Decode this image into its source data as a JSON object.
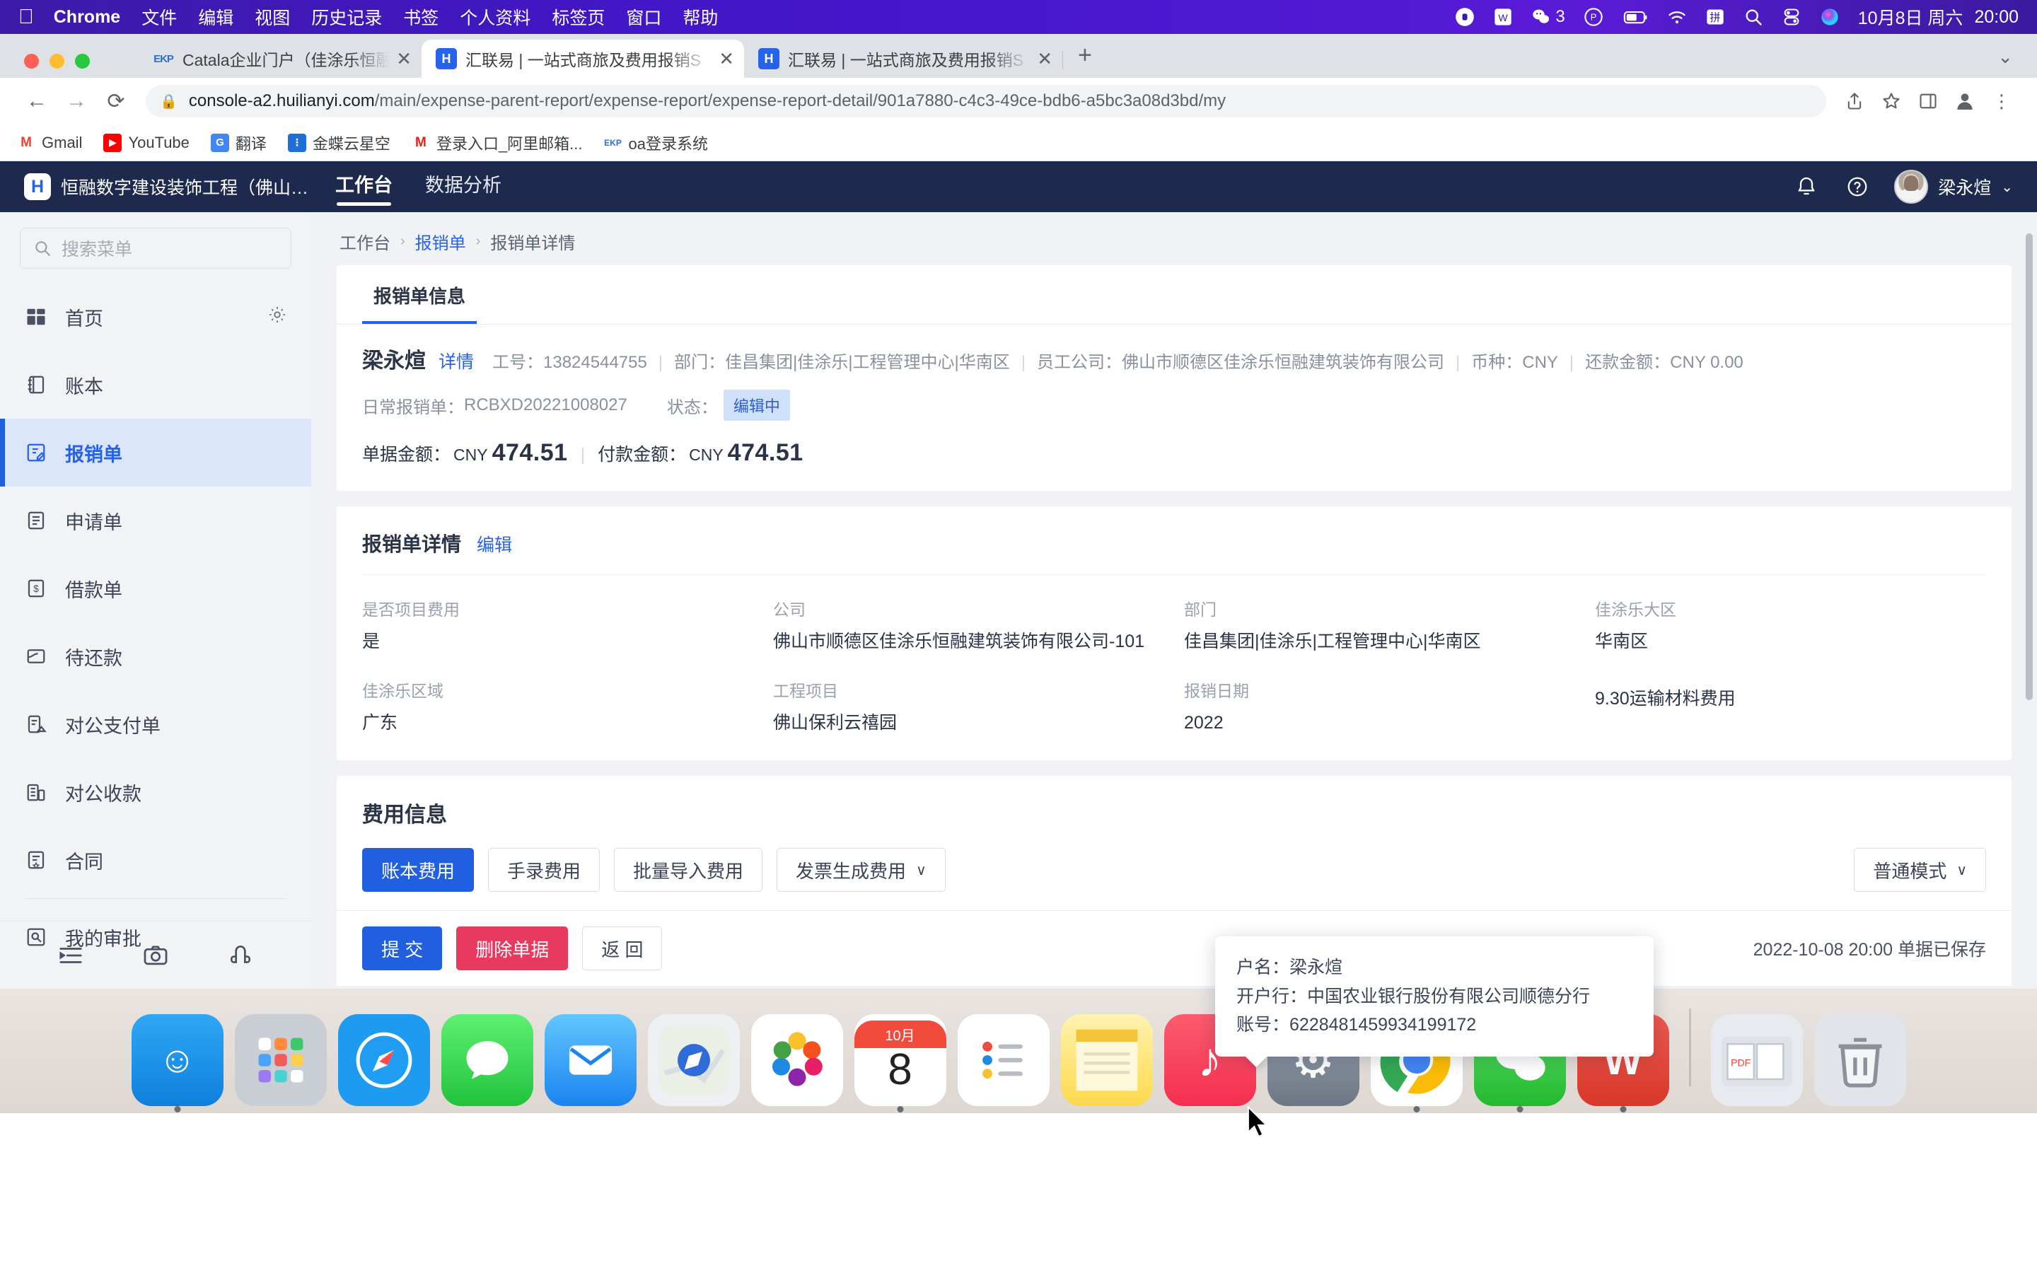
{
  "macos": {
    "menus": [
      "Chrome",
      "文件",
      "编辑",
      "视图",
      "历史记录",
      "书签",
      "个人资料",
      "标签页",
      "窗口",
      "帮助"
    ],
    "status": {
      "wechat_badge": "3",
      "date": "10月8日 周六",
      "time": "20:00",
      "icons": [
        "onepassword-icon",
        "wps-icon",
        "wechat-icon",
        "vpn-icon",
        "battery-icon",
        "wifi-icon",
        "input-method-icon",
        "search-icon",
        "control-center-icon",
        "siri-icon"
      ]
    }
  },
  "browser": {
    "tabs": [
      {
        "title": "Catala企业门户（佳涂乐恒融建筑",
        "favicon": "ekp-icon",
        "active": false
      },
      {
        "title": "汇联易 | 一站式商旅及费用报销S",
        "favicon": "huilianyi-icon",
        "active": true
      },
      {
        "title": "汇联易 | 一站式商旅及费用报销S",
        "favicon": "huilianyi-icon",
        "active": false
      }
    ],
    "new_tab_label": "+",
    "url_domain": "console-a2.huilianyi.com",
    "url_path": "/main/expense-parent-report/expense-report/expense-report-detail/901a7880-c4c3-49ce-bdb6-a5bc3a08d3bd/my",
    "bookmarks": [
      {
        "label": "Gmail",
        "icon": "gmail-icon",
        "glyph": "M",
        "color": "#ea4335",
        "bg": "#ffffff"
      },
      {
        "label": "YouTube",
        "icon": "youtube-icon",
        "glyph": "▶",
        "color": "#ffffff",
        "bg": "#ff0000"
      },
      {
        "label": "翻译",
        "icon": "google-translate-icon",
        "glyph": "G",
        "color": "#ffffff",
        "bg": "#4285f4"
      },
      {
        "label": "金蝶云星空",
        "icon": "kingdee-icon",
        "glyph": "K",
        "color": "#ffffff",
        "bg": "#1e6fd9"
      },
      {
        "label": "登录入口_阿里邮箱...",
        "icon": "alimail-icon",
        "glyph": "M",
        "color": "#e62117",
        "bg": "#ffffff"
      },
      {
        "label": "oa登录系统",
        "icon": "ekp-icon",
        "glyph": "E",
        "color": "#2c6fd1",
        "bg": "#ffffff"
      }
    ]
  },
  "app": {
    "brand_name": "恒融数字建设装饰工程（佛山…",
    "brand_logo_glyph": "H",
    "nav_tabs": [
      {
        "label": "工作台",
        "active": true
      },
      {
        "label": "数据分析",
        "active": false
      }
    ],
    "user_name": "梁永煊",
    "header_icons": [
      "bell-icon",
      "help-icon"
    ],
    "sidebar": {
      "search_placeholder": "搜索菜单",
      "items": [
        {
          "label": "首页",
          "icon": "dashboard-icon",
          "active": false,
          "trailing": "gear-icon"
        },
        {
          "label": "账本",
          "icon": "ledger-icon",
          "active": false
        },
        {
          "label": "报销单",
          "icon": "expense-report-icon",
          "active": true
        },
        {
          "label": "申请单",
          "icon": "application-form-icon",
          "active": false
        },
        {
          "label": "借款单",
          "icon": "loan-form-icon",
          "active": false
        },
        {
          "label": "待还款",
          "icon": "repayment-icon",
          "active": false
        },
        {
          "label": "对公支付单",
          "icon": "corporate-payment-icon",
          "active": false
        },
        {
          "label": "对公收款",
          "icon": "corporate-receipt-icon",
          "active": false
        },
        {
          "label": "合同",
          "icon": "contract-icon",
          "active": false
        },
        {
          "label": "我的审批",
          "icon": "my-approval-icon",
          "active": false,
          "separator_before": true
        }
      ],
      "footer_icons": [
        "collapse-sidebar-icon",
        "camera-icon",
        "feedback-icon"
      ]
    },
    "breadcrumb": [
      "工作台",
      "报销单",
      "报销单详情"
    ],
    "card_tab": "报销单信息",
    "summary": {
      "name": "梁永煊",
      "detail_link": "详情",
      "employee_no_label": "工号：",
      "employee_no": "13824544755",
      "department_label": "部门：",
      "department": "佳昌集团|佳涂乐|工程管理中心|华南区",
      "company_label": "员工公司：",
      "company": "佛山市顺德区佳涂乐恒融建筑装饰有限公司",
      "currency_label": "币种：",
      "currency": "CNY",
      "repay_label": "还款金额：",
      "repay_amount": "CNY 0.00",
      "form_type_label": "日常报销单：",
      "form_no": "RCBXD20221008027",
      "status_label": "状态：",
      "status": "编辑中",
      "doc_amount_label": "单据金额：",
      "doc_amount_currency": "CNY",
      "doc_amount": "474.51",
      "pay_amount_label": "付款金额：",
      "pay_amount_currency": "CNY",
      "pay_amount": "474.51"
    },
    "details": {
      "title": "报销单详情",
      "edit_link": "编辑",
      "fields": [
        {
          "label": "是否项目费用",
          "value": "是"
        },
        {
          "label": "公司",
          "value": "佛山市顺德区佳涂乐恒融建筑装饰有限公司-101"
        },
        {
          "label": "部门",
          "value": "佳昌集团|佳涂乐|工程管理中心|华南区"
        },
        {
          "label": "佳涂乐大区",
          "value": "华南区"
        },
        {
          "label": "佳涂乐区域",
          "value": "广东"
        },
        {
          "label": "工程项目",
          "value": "佛山保利云禧园"
        },
        {
          "label": "报销日期",
          "value": "2022"
        },
        {
          "label": "",
          "value": "9.30运输材料费用"
        }
      ]
    },
    "tooltip": {
      "account_name_label": "户名：",
      "account_name": "梁永煊",
      "bank_label": "开户行：",
      "bank": "中国农业银行股份有限公司顺德分行",
      "account_no_label": "账号：",
      "account_no": "6228481459934199172"
    },
    "expense": {
      "title": "费用信息",
      "tabs": [
        {
          "label": "账本费用",
          "active": true
        },
        {
          "label": "手录费用",
          "active": false
        },
        {
          "label": "批量导入费用",
          "active": false
        },
        {
          "label": "发票生成费用",
          "active": false,
          "chevron": "∨"
        }
      ],
      "mode_button": "普通模式",
      "mode_chevron": "∨",
      "actions": [
        {
          "label": "提 交",
          "style": "primary"
        },
        {
          "label": "删除单据",
          "style": "danger"
        },
        {
          "label": "返 回",
          "style": "default"
        }
      ],
      "save_stamp": "2022-10-08 20:00 单据已保存"
    }
  },
  "dock": {
    "items": [
      {
        "name": "finder",
        "bg": "#1f9af6",
        "glyph": "☺"
      },
      {
        "name": "launchpad",
        "bg": "#c9cdd4",
        "glyph": "⠿"
      },
      {
        "name": "safari",
        "bg": "#2fa5f7",
        "glyph": "🧭"
      },
      {
        "name": "messages",
        "bg": "#37d047",
        "glyph": "💬"
      },
      {
        "name": "mail",
        "bg": "#3aa3f7",
        "glyph": "✉"
      },
      {
        "name": "maps",
        "bg": "#eef1f4",
        "glyph": "➤"
      },
      {
        "name": "photos",
        "bg": "#fdfdfd",
        "glyph": "❋"
      },
      {
        "name": "calendar",
        "bg": "#ffffff",
        "glyph": "8",
        "sub": "10月"
      },
      {
        "name": "reminders",
        "bg": "#ffffff",
        "glyph": "☰"
      },
      {
        "name": "notes",
        "bg": "#fddb5a",
        "glyph": "▤"
      },
      {
        "name": "music",
        "bg": "#fa4f5e",
        "glyph": "♪"
      },
      {
        "name": "settings",
        "bg": "#8e98a6",
        "glyph": "⚙"
      },
      {
        "name": "chrome",
        "bg": "#ffffff",
        "glyph": "◉"
      },
      {
        "name": "wechat",
        "bg": "#3ec23e",
        "glyph": "💬"
      },
      {
        "name": "wps",
        "bg": "#e8453c",
        "glyph": "W"
      },
      {
        "name": "pdf-folder",
        "bg": "#e3e6ea",
        "glyph": "▤"
      },
      {
        "name": "trash",
        "bg": "#dfe3e8",
        "glyph": "🗑"
      }
    ]
  }
}
